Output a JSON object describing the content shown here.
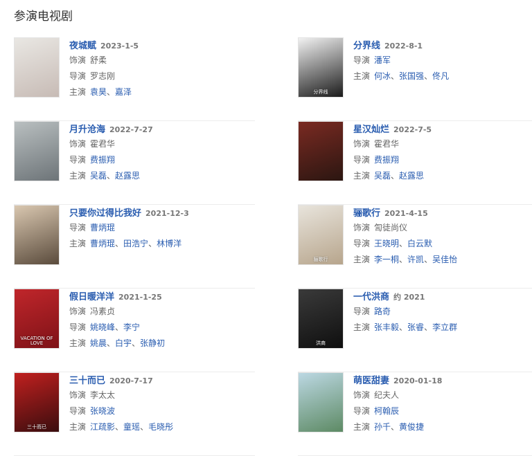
{
  "section": {
    "title": "参演电视剧"
  },
  "items": [
    {
      "title": "夜城赋",
      "date": "2023-1-5",
      "poster": {
        "colors": [
          "#e9e7e3",
          "#c7bbb5"
        ],
        "text": ""
      },
      "rows": [
        {
          "label": "饰演",
          "values": [
            "舒柔"
          ],
          "linked": false
        },
        {
          "label": "导演",
          "values": [
            "罗志刚"
          ],
          "linked": false
        },
        {
          "label": "主演",
          "values": [
            "袁昊",
            "嘉泽"
          ],
          "linked": true
        }
      ]
    },
    {
      "title": "分界线",
      "date": "2022-8-1",
      "poster": {
        "colors": [
          "#f2f2f2",
          "#1b1b1b"
        ],
        "text": "分界线"
      },
      "rows": [
        {
          "label": "导演",
          "values": [
            "潘军"
          ],
          "linked": true
        },
        {
          "label": "主演",
          "values": [
            "何冰",
            "张国强",
            "佟凡"
          ],
          "linked": true
        }
      ]
    },
    {
      "title": "月升沧海",
      "date": "2022-7-27",
      "poster": {
        "colors": [
          "#b9bfc0",
          "#6d7478"
        ],
        "text": ""
      },
      "rows": [
        {
          "label": "饰演",
          "values": [
            "霍君华"
          ],
          "linked": false
        },
        {
          "label": "导演",
          "values": [
            "费振翔"
          ],
          "linked": true
        },
        {
          "label": "主演",
          "values": [
            "吴磊",
            "赵露思"
          ],
          "linked": true
        }
      ]
    },
    {
      "title": "星汉灿烂",
      "date": "2022-7-5",
      "poster": {
        "colors": [
          "#7a2a22",
          "#2b1611"
        ],
        "text": ""
      },
      "rows": [
        {
          "label": "饰演",
          "values": [
            "霍君华"
          ],
          "linked": false
        },
        {
          "label": "导演",
          "values": [
            "费振翔"
          ],
          "linked": true
        },
        {
          "label": "主演",
          "values": [
            "吴磊",
            "赵露思"
          ],
          "linked": true
        }
      ]
    },
    {
      "title": "只要你过得比我好",
      "date": "2021-12-3",
      "poster": {
        "colors": [
          "#d9c7b0",
          "#5a4b3c"
        ],
        "text": ""
      },
      "rows": [
        {
          "label": "导演",
          "values": [
            "曹炳琨"
          ],
          "linked": true
        },
        {
          "label": "主演",
          "values": [
            "曹炳琨",
            "田浩宁",
            "林博洋"
          ],
          "linked": true
        }
      ]
    },
    {
      "title": "骊歌行",
      "date": "2021-4-15",
      "poster": {
        "colors": [
          "#e8e4dc",
          "#b7a58c"
        ],
        "text": "骊歌行"
      },
      "rows": [
        {
          "label": "饰演",
          "values": [
            "訇徒尚仪"
          ],
          "linked": false
        },
        {
          "label": "导演",
          "values": [
            "王晓明",
            "白云默"
          ],
          "linked": true
        },
        {
          "label": "主演",
          "values": [
            "李一桐",
            "许凯",
            "吴佳怡"
          ],
          "linked": true
        }
      ]
    },
    {
      "title": "假日暖洋洋",
      "date": "2021-1-25",
      "poster": {
        "colors": [
          "#c0262b",
          "#7e1217"
        ],
        "text": "VACATION OF LOVE"
      },
      "rows": [
        {
          "label": "饰演",
          "values": [
            "冯素贞"
          ],
          "linked": false
        },
        {
          "label": "导演",
          "values": [
            "姚晓峰",
            "李宁"
          ],
          "linked": true
        },
        {
          "label": "主演",
          "values": [
            "姚晨",
            "白宇",
            "张静初"
          ],
          "linked": true
        }
      ]
    },
    {
      "title": "一代洪商",
      "date": "约 2021",
      "poster": {
        "colors": [
          "#3a3a3a",
          "#0f0f0f"
        ],
        "text": "洪商"
      },
      "rows": [
        {
          "label": "导演",
          "values": [
            "路奇"
          ],
          "linked": true
        },
        {
          "label": "主演",
          "values": [
            "张丰毅",
            "张睿",
            "李立群"
          ],
          "linked": true
        }
      ]
    },
    {
      "title": "三十而已",
      "date": "2020-7-17",
      "poster": {
        "colors": [
          "#c0201f",
          "#3a0d0e"
        ],
        "text": "三十而已"
      },
      "rows": [
        {
          "label": "饰演",
          "values": [
            "李太太"
          ],
          "linked": false
        },
        {
          "label": "导演",
          "values": [
            "张晓波"
          ],
          "linked": true
        },
        {
          "label": "主演",
          "values": [
            "江疏影",
            "童瑶",
            "毛晓彤"
          ],
          "linked": true
        }
      ]
    },
    {
      "title": "萌医甜妻",
      "date": "2020-01-18",
      "poster": {
        "colors": [
          "#bcd8e3",
          "#5d8a64"
        ],
        "text": ""
      },
      "rows": [
        {
          "label": "饰演",
          "values": [
            "纪夫人"
          ],
          "linked": false
        },
        {
          "label": "导演",
          "values": [
            "柯翰辰"
          ],
          "linked": true
        },
        {
          "label": "主演",
          "values": [
            "孙千",
            "黄俊捷"
          ],
          "linked": true
        }
      ]
    }
  ]
}
